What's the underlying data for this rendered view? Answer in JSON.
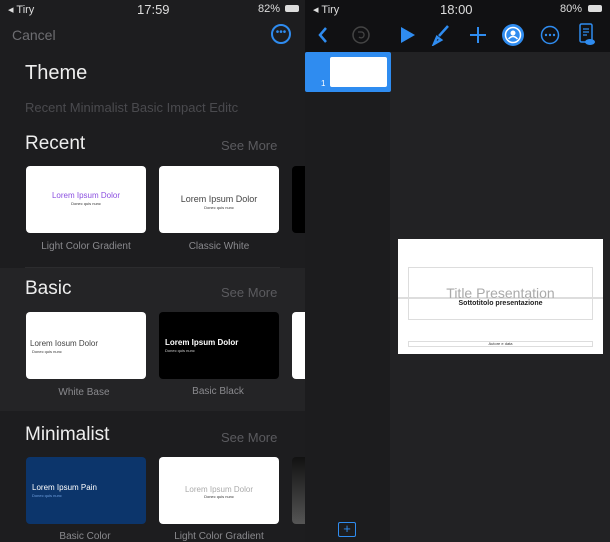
{
  "left": {
    "status": {
      "carrier": "◂ Tiry",
      "time": "17:59",
      "battery": "82%"
    },
    "cancel": "Cancel",
    "title": "Theme",
    "categories": "Recent Minimalist Basic Impact Editc",
    "sections": [
      {
        "title": "Recent",
        "see_more": "See More",
        "items": [
          {
            "label": "Light Color Gradient",
            "heading": "Lorem Ipsum Dolor",
            "sub": "Donec quis nunc",
            "bg": "#ffffff",
            "fg": "#8b4fe0"
          },
          {
            "label": "Classic White",
            "heading": "Lorem Ipsum Dolor",
            "sub": "Donec quis nunc",
            "bg": "#ffffff",
            "fg": "#444444"
          }
        ]
      },
      {
        "title": "Basic",
        "see_more": "See More",
        "items": [
          {
            "label": "White Base",
            "heading": "Lorem Iosum Dolor",
            "sub": "Donec quis nunc",
            "bg": "#ffffff",
            "fg": "#444444"
          },
          {
            "label": "Basic Black",
            "heading": "Lorem Ipsum Dolor",
            "sub": "Donec quis nunc",
            "bg": "#000000",
            "fg": "#ffffff"
          }
        ]
      },
      {
        "title": "Minimalist",
        "see_more": "See More",
        "items": [
          {
            "label": "Basic Color",
            "heading": "Lorem Ipsum Pain",
            "sub": "Donec quis nunc",
            "bg": "#0c356b",
            "fg": "#ffffff"
          },
          {
            "label": "Light Color Gradient",
            "heading": "Lorem Ipsum Dolor",
            "sub": "Donec quis nunc",
            "bg": "#ffffff",
            "fg": "#aaaaaa"
          }
        ]
      }
    ]
  },
  "right": {
    "status": {
      "carrier": "◂ Tiry",
      "time": "18:00",
      "battery": "80%"
    },
    "slide_number": "1",
    "slide": {
      "title": "Title Presentation",
      "subtitle": "Sottotitolo presentazione",
      "footer": "Autore e data"
    },
    "accent": "#2f8cf0"
  }
}
